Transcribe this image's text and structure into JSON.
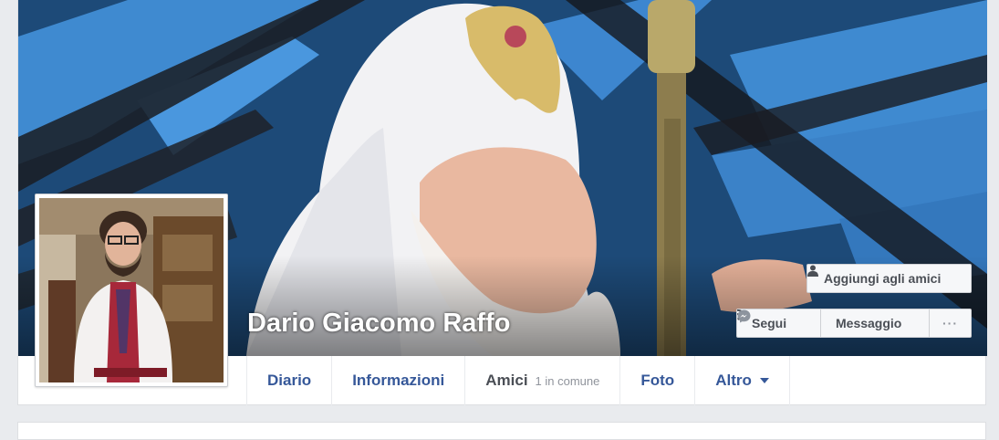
{
  "profile": {
    "name": "Dario Giacomo Raffo"
  },
  "actions": {
    "add_friend": "Aggiungi agli amici",
    "follow": "Segui",
    "message": "Messaggio",
    "more": "···"
  },
  "tabs": [
    {
      "label": "Diario"
    },
    {
      "label": "Informazioni"
    },
    {
      "label": "Amici",
      "sub": "1 in comune"
    },
    {
      "label": "Foto"
    },
    {
      "label": "Altro"
    }
  ],
  "icons": {
    "add_friend": "person-add-icon",
    "follow": "rss-icon",
    "message": "messenger-icon",
    "more_caret": "caret-down-icon"
  },
  "colors": {
    "link": "#365899",
    "button_text": "#4b4f56",
    "muted": "#90949c",
    "page_bg": "#e9ebee"
  }
}
